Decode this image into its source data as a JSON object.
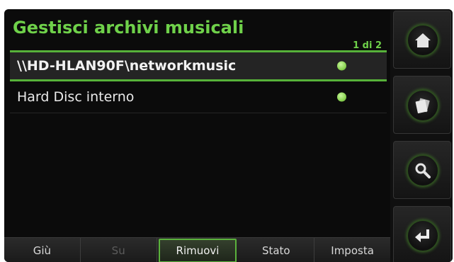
{
  "header": {
    "title": "Gestisci archivi musicali",
    "page_indicator": "1 di 2"
  },
  "list": {
    "items": [
      {
        "label": "\\\\HD-HLAN90F\\networkmusic",
        "selected": true,
        "status": "green-dot-icon"
      },
      {
        "label": "Hard Disc interno",
        "selected": false,
        "status": "green-dot-icon"
      }
    ]
  },
  "bottombar": {
    "buttons": [
      {
        "label": "Giù",
        "enabled": true
      },
      {
        "label": "Su",
        "enabled": false
      },
      {
        "label": "Rimuovi",
        "enabled": true,
        "active": true
      },
      {
        "label": "Stato",
        "enabled": true
      },
      {
        "label": "Imposta",
        "enabled": true
      }
    ]
  },
  "sidebar": {
    "buttons": [
      {
        "icon": "home-icon"
      },
      {
        "icon": "media-library-icon"
      },
      {
        "icon": "search-icon"
      },
      {
        "icon": "back-arrow-icon"
      }
    ]
  },
  "colors": {
    "accent": "#6fd14a",
    "background": "#0b0b0b"
  }
}
